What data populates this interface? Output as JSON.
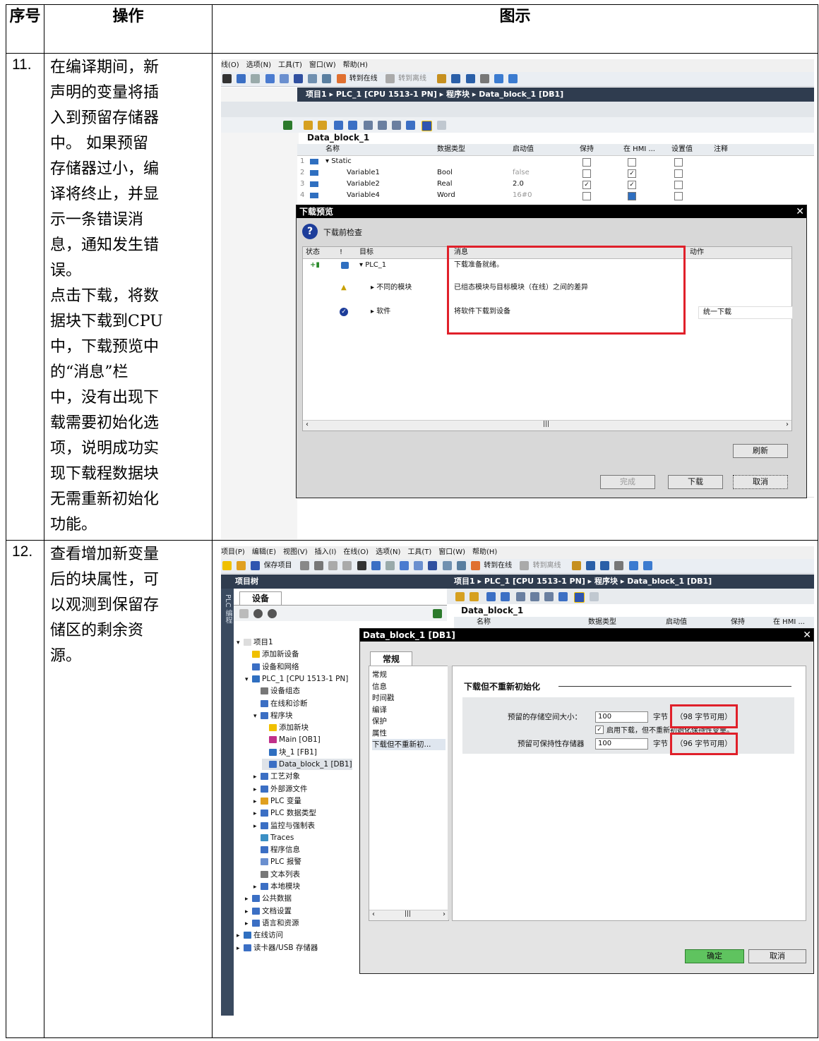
{
  "header": {
    "seq": "序号",
    "op": "操作",
    "fig": "图示"
  },
  "rows": [
    {
      "num": "11.",
      "text": [
        "在编译期间，新",
        "声明的变量将插",
        "入到预留存储器",
        "中。 如果预留",
        "存储器过小，编",
        "译将终止，并显",
        "示一条错误消",
        "息，通知发生错",
        "误。",
        "点击下载，将数",
        "据块下载到CPU",
        "中，下载预览中",
        "的“消息”栏",
        "中，没有出现下",
        "载需要初始化选",
        "项，说明成功实",
        "现下载程数据块",
        "无需重新初始化",
        "功能。"
      ]
    },
    {
      "num": "12.",
      "text": [
        "查看增加新变量",
        "后的块属性，可",
        "以观测到保留存",
        "储区的剩余资",
        "源。"
      ]
    }
  ],
  "shot1": {
    "menu": [
      "线(O)",
      "选项(N)",
      "工具(T)",
      "窗口(W)",
      "帮助(H)"
    ],
    "toolbar": {
      "go_online": "转到在线",
      "go_offline": "转到离线"
    },
    "breadcrumb": "项目1 ▸ PLC_1 [CPU 1513-1 PN] ▸ 程序块 ▸ Data_block_1 [DB1]",
    "block_name": "Data_block_1",
    "columns": [
      "名称",
      "数据类型",
      "启动值",
      "保持",
      "在 HMI ...",
      "设置值",
      "注释"
    ],
    "rows": [
      {
        "n": "1",
        "name": "Static",
        "type": "",
        "start": ""
      },
      {
        "n": "2",
        "name": "Variable1",
        "type": "Bool",
        "start": "false"
      },
      {
        "n": "3",
        "name": "Variable2",
        "type": "Real",
        "start": "2.0"
      },
      {
        "n": "4",
        "name": "Variable4",
        "type": "Word",
        "start": "16#0"
      }
    ],
    "dialog": {
      "title": "下载预览",
      "check": "下载前检查",
      "cols": [
        "状态",
        "!",
        "目标",
        "消息",
        "动作"
      ],
      "items": [
        {
          "target": "PLC_1",
          "msg": "下载准备就绪。",
          "action": ""
        },
        {
          "target": "不同的模块",
          "msg": "已组态模块与目标模块（在线）之间的差异",
          "action": ""
        },
        {
          "target": "软件",
          "msg": "将软件下载到设备",
          "action": "统一下载"
        }
      ],
      "refresh": "刷新",
      "finish": "完成",
      "download": "下载",
      "cancel": "取消"
    }
  },
  "shot2": {
    "menu": [
      "项目(P)",
      "编辑(E)",
      "视图(V)",
      "插入(I)",
      "在线(O)",
      "选项(N)",
      "工具(T)",
      "窗口(W)",
      "帮助(H)"
    ],
    "toolbar": {
      "save": "保存项目",
      "go_online": "转到在线",
      "go_offline": "转到离线"
    },
    "project_tree": "项目树",
    "devices_tab": "设备",
    "side_label": "PLC 编程",
    "breadcrumb": "项目1 ▸ PLC_1 [CPU 1513-1 PN] ▸ 程序块 ▸ Data_block_1 [DB1]",
    "block_name": "Data_block_1",
    "columns": [
      "名称",
      "数据类型",
      "启动值",
      "保持",
      "在 HMI ..."
    ],
    "tree": [
      "项目1",
      "添加新设备",
      "设备和网络",
      "PLC_1 [CPU 1513-1 PN]",
      "设备组态",
      "在线和诊断",
      "程序块",
      "添加新块",
      "Main [OB1]",
      "块_1 [FB1]",
      "Data_block_1 [DB1]",
      "工艺对象",
      "外部源文件",
      "PLC 变量",
      "PLC 数据类型",
      "监控与强制表",
      "Traces",
      "程序信息",
      "PLC 报警",
      "文本列表",
      "本地模块",
      "公共数据",
      "文档设置",
      "语言和资源",
      "在线访问",
      "读卡器/USB 存储器"
    ],
    "dialog": {
      "title": "Data_block_1 [DB1]",
      "tab": "常规",
      "nav": [
        "常规",
        "信息",
        "时间戳",
        "编译",
        "保护",
        "属性",
        "下载但不重新初..."
      ],
      "section": "下载但不重新初始化",
      "reserved_label": "预留的存储空间大小：",
      "reserved_value": "100",
      "unit": "字节",
      "reserved_avail": "（98 字节可用）",
      "enable_label": "启用下载，但不重新初始化保持性变量。",
      "retain_label": "预留可保持性存储器",
      "retain_value": "100",
      "retain_avail": "（96 字节可用）",
      "ok": "确定",
      "cancel": "取消"
    }
  },
  "colors": {
    "red": "#e0202a",
    "title_dark": "#2f3c4f",
    "ok_green": "#5fc35f"
  }
}
